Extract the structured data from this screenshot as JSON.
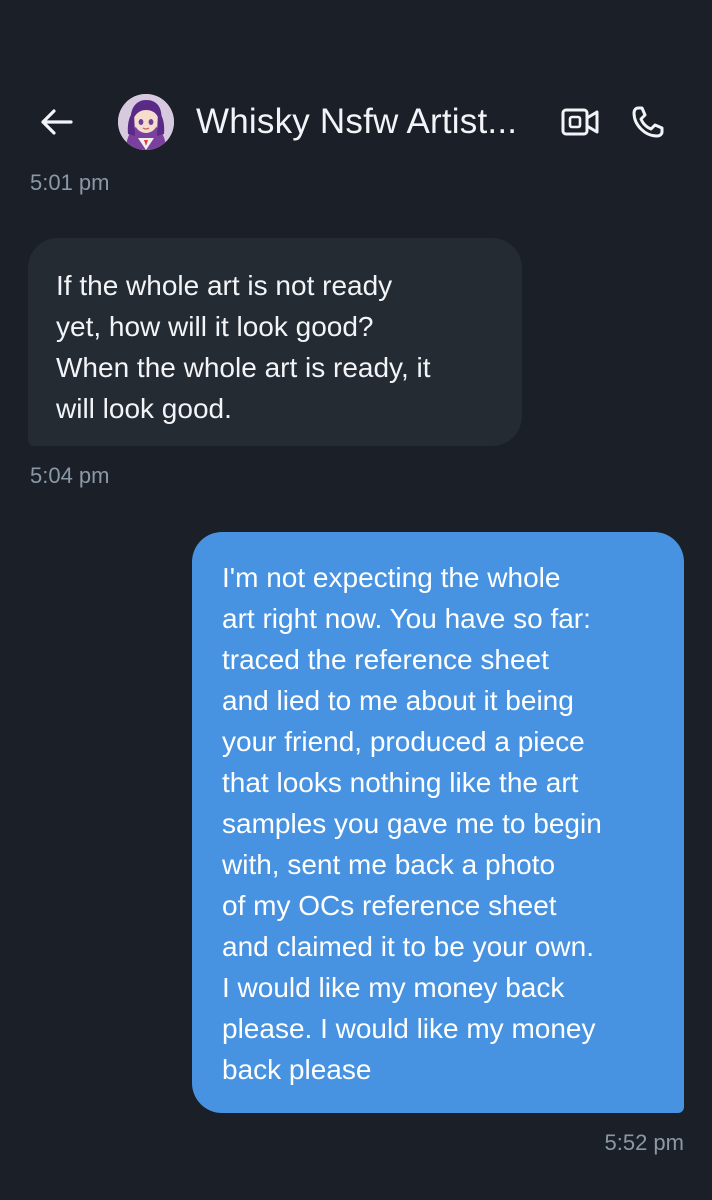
{
  "header": {
    "back_label": "←",
    "title": "Whisky Nsfw Artist...",
    "avatar_icon": "anime-avatar",
    "video_icon": "video-call-icon",
    "call_icon": "phone-icon"
  },
  "messages": [
    {
      "type": "timestamp",
      "text": "5:01 pm"
    },
    {
      "type": "incoming",
      "lines": [
        "If the whole art is not ready",
        "yet, how will it look good?",
        "When the whole art is ready, it",
        "will look good."
      ],
      "time": "5:04 pm"
    },
    {
      "type": "outgoing",
      "lines": [
        "I'm not expecting the whole",
        "art right now. You have so far:",
        "traced the reference sheet",
        "and lied to me about it being",
        "your friend, produced a piece",
        "that looks nothing like the art",
        "samples you gave me to begin",
        "with, sent me back a photo",
        "of my OCs reference sheet",
        "and claimed it to be your own.",
        "I would like my money back",
        "please. I would like my money",
        "back please"
      ],
      "time": "5:52 pm"
    }
  ],
  "colors": {
    "background": "#1a1f28",
    "incoming_bubble": "#242b33",
    "outgoing_bubble": "#4793e2",
    "timestamp": "#8b98a5"
  }
}
